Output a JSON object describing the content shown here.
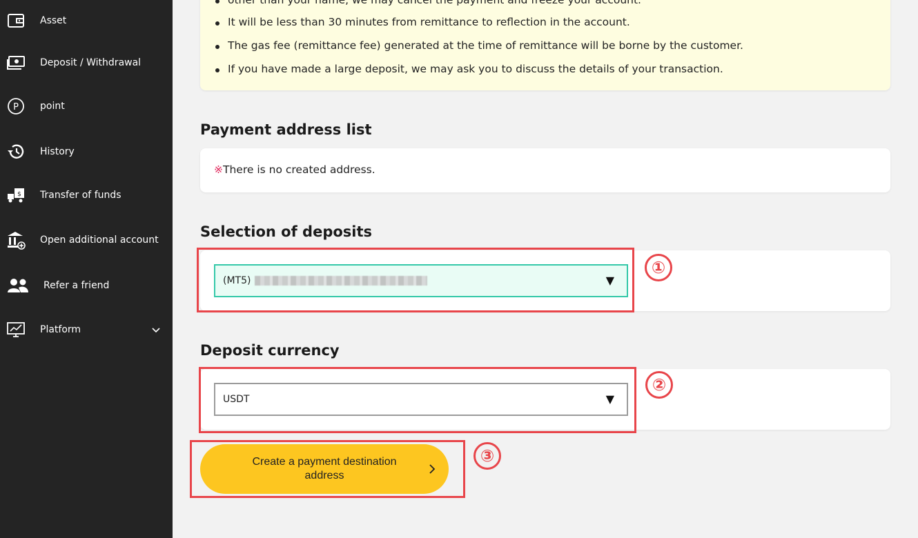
{
  "sidebar": {
    "items": [
      {
        "label": "Asset",
        "icon": "wallet-icon"
      },
      {
        "label": "Deposit / Withdrawal",
        "icon": "cash-icon"
      },
      {
        "label": "point",
        "icon": "point-icon"
      },
      {
        "label": "History",
        "icon": "history-icon"
      },
      {
        "label": "Transfer of funds",
        "icon": "transfer-truck-icon"
      },
      {
        "label": "Open additional account",
        "icon": "bank-add-icon"
      },
      {
        "label": "Refer a friend",
        "icon": "users-icon"
      },
      {
        "label": "Platform",
        "icon": "chart-monitor-icon"
      }
    ]
  },
  "notice": {
    "items": [
      "other than your name, we may cancel the payment and freeze your account.",
      "It will be less than 30 minutes from remittance to reflection in the account.",
      "The gas fee (remittance fee) generated at the time of remittance will be borne by the customer.",
      "If you have made a large deposit, we may ask you to discuss the details of your transaction."
    ]
  },
  "payment_list": {
    "title": "Payment address list",
    "mark": "※",
    "empty_text": "There is no created address."
  },
  "deposits": {
    "title": "Selection of deposits",
    "selected_value": "(MT5)",
    "arrow": "▼"
  },
  "currency": {
    "title": "Deposit currency",
    "selected_value": "USDT",
    "arrow": "▼"
  },
  "cta": {
    "label": "Create a payment destination address"
  },
  "annotations": {
    "step1": "①",
    "step2": "②",
    "step3": "③"
  },
  "colors": {
    "sidebar_bg": "#242424",
    "accent_yellow": "#fdc620",
    "highlight_red": "#e8454a",
    "select_highlight": "#33c8a8",
    "notice_bg": "#fefde0"
  }
}
